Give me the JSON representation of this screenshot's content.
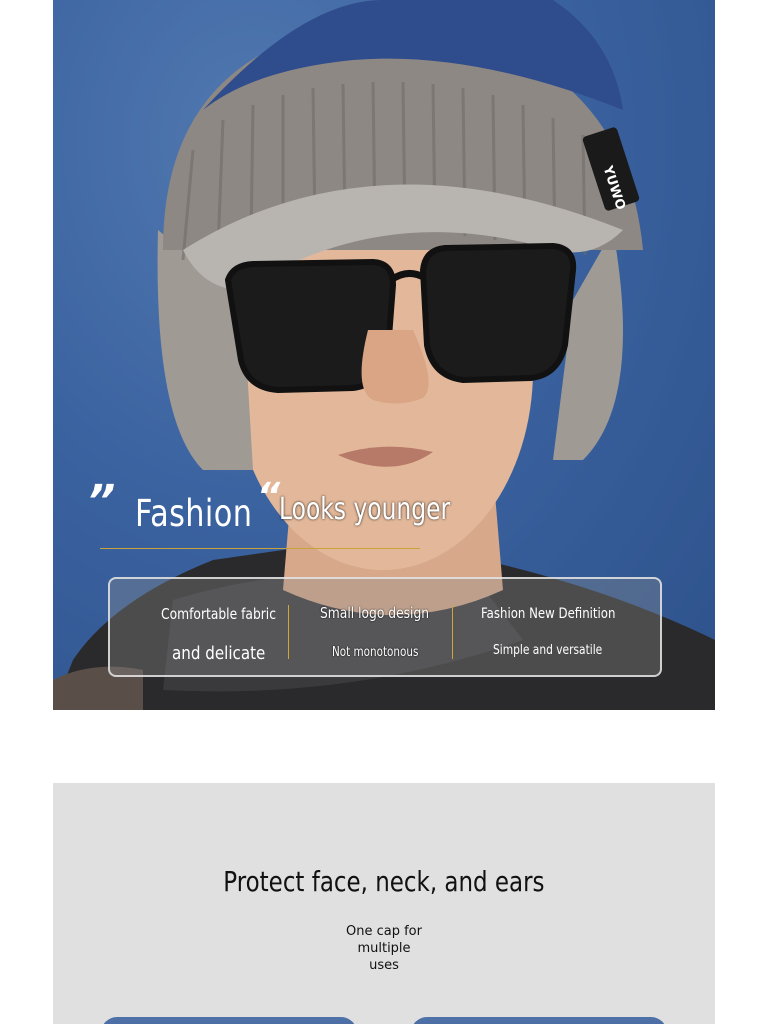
{
  "hero": {
    "quote_open": "”",
    "quote_close": "“",
    "fashion": "Fashion",
    "looks_younger": "Looks younger",
    "badge_text": "YUWO",
    "features": [
      {
        "title": "Comfortable fabric",
        "subtitle": "and delicate"
      },
      {
        "title": "Small logo design",
        "subtitle": "Not monotonous"
      },
      {
        "title": "Fashion New Definition",
        "subtitle": "Simple and versatile"
      }
    ]
  },
  "section2": {
    "title": "Protect face, neck, and ears",
    "subtitle_line1": "One cap for multiple",
    "subtitle_line2": "uses"
  },
  "colors": {
    "accent_gold": "#c9a23a",
    "section_bg": "#e0e0e0"
  }
}
